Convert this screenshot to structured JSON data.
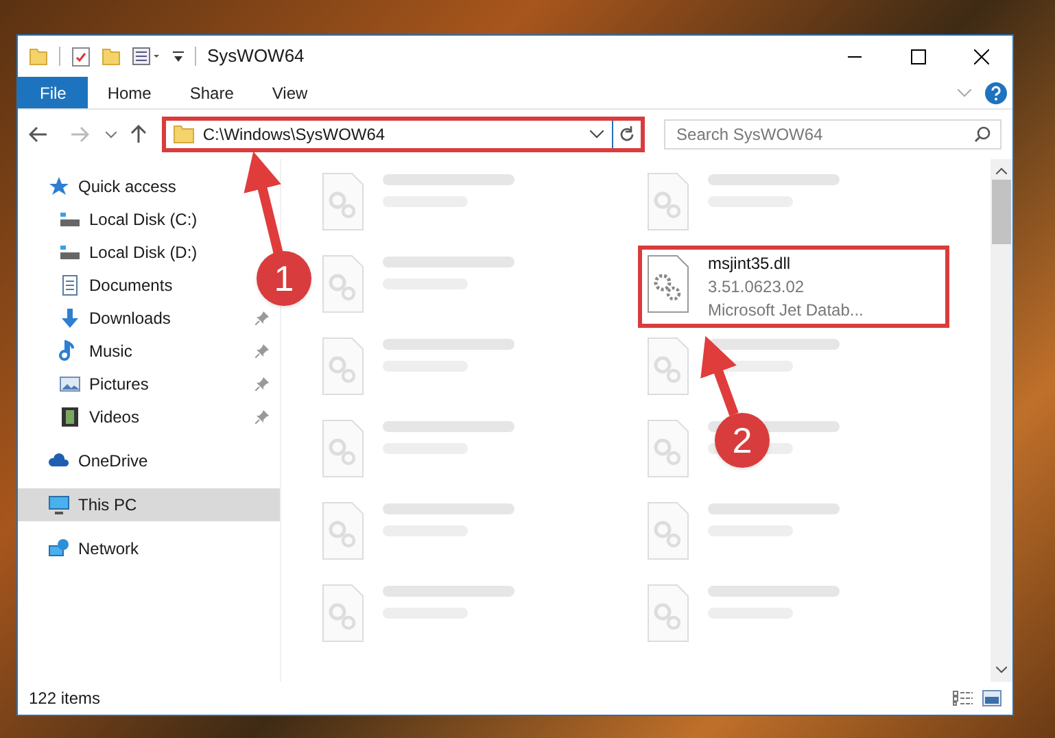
{
  "window": {
    "title": "SysWOW64"
  },
  "ribbon_tabs": [
    {
      "label": "File",
      "selected": true
    },
    {
      "label": "Home",
      "selected": false
    },
    {
      "label": "Share",
      "selected": false
    },
    {
      "label": "View",
      "selected": false
    }
  ],
  "address": {
    "path": "C:\\Windows\\SysWOW64",
    "highlighted": true
  },
  "search": {
    "placeholder": "Search SysWOW64"
  },
  "sidebar": {
    "items": [
      {
        "label": "Quick access",
        "kind": "star",
        "selected": false,
        "children": [
          {
            "label": "Local Disk (C:)",
            "kind": "drive",
            "pinned": false
          },
          {
            "label": "Local Disk (D:)",
            "kind": "drive",
            "pinned": false
          },
          {
            "label": "Documents",
            "kind": "doc",
            "pinned": false
          },
          {
            "label": "Downloads",
            "kind": "down",
            "pinned": true
          },
          {
            "label": "Music",
            "kind": "music",
            "pinned": true
          },
          {
            "label": "Pictures",
            "kind": "pic",
            "pinned": true
          },
          {
            "label": "Videos",
            "kind": "video",
            "pinned": true
          }
        ]
      },
      {
        "label": "OneDrive",
        "kind": "cloud",
        "selected": false
      },
      {
        "label": "This PC",
        "kind": "pc",
        "selected": true
      },
      {
        "label": "Network",
        "kind": "net",
        "selected": false
      }
    ]
  },
  "files": [
    {
      "kind": "blurred"
    },
    {
      "kind": "blurred"
    },
    {
      "kind": "blurred"
    },
    {
      "kind": "file",
      "name": "msjint35.dll",
      "details": [
        "3.51.0623.02",
        "Microsoft Jet Datab..."
      ],
      "highlighted": true
    },
    {
      "kind": "blurred"
    },
    {
      "kind": "blurred"
    },
    {
      "kind": "blurred"
    },
    {
      "kind": "blurred"
    },
    {
      "kind": "blurred"
    },
    {
      "kind": "blurred"
    },
    {
      "kind": "blurred"
    },
    {
      "kind": "blurred"
    }
  ],
  "status_bar": {
    "count": "122 items"
  },
  "annotations": [
    {
      "label": "1"
    },
    {
      "label": "2"
    }
  ]
}
